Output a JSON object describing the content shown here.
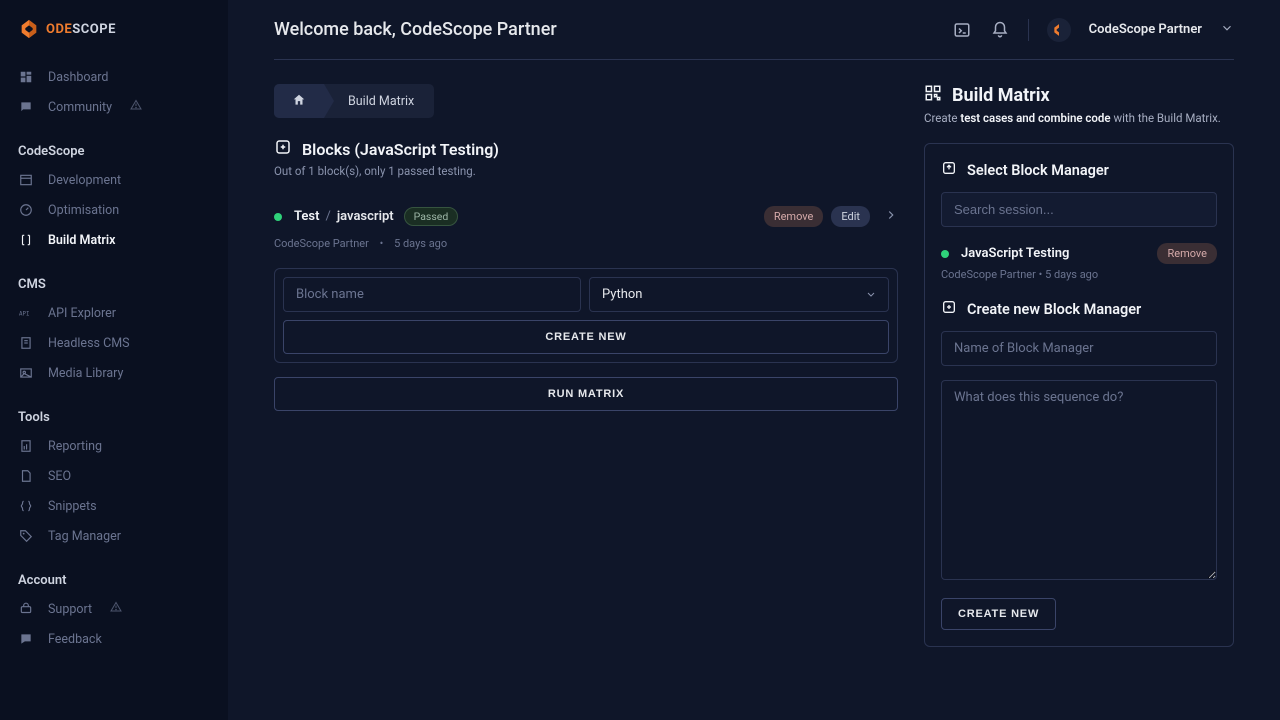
{
  "brand": {
    "code": "ODE",
    "scope": "SCOPE"
  },
  "header": {
    "welcome": "Welcome back, CodeScope Partner",
    "user_name": "CodeScope Partner"
  },
  "sidebar": {
    "top": [
      {
        "label": "Dashboard"
      },
      {
        "label": "Community"
      }
    ],
    "groups": [
      {
        "heading": "CodeScope",
        "items": [
          {
            "label": "Development"
          },
          {
            "label": "Optimisation"
          },
          {
            "label": "Build Matrix",
            "active": true
          }
        ]
      },
      {
        "heading": "CMS",
        "items": [
          {
            "label": "API Explorer"
          },
          {
            "label": "Headless CMS"
          },
          {
            "label": "Media Library"
          }
        ]
      },
      {
        "heading": "Tools",
        "items": [
          {
            "label": "Reporting"
          },
          {
            "label": "SEO"
          },
          {
            "label": "Snippets"
          },
          {
            "label": "Tag Manager"
          }
        ]
      },
      {
        "heading": "Account",
        "items": [
          {
            "label": "Support"
          },
          {
            "label": "Feedback"
          }
        ]
      }
    ]
  },
  "breadcrumb": {
    "current": "Build Matrix"
  },
  "blocks": {
    "title": "Blocks (JavaScript Testing)",
    "subtitle": "Out of 1 block(s), only 1 passed testing.",
    "items": [
      {
        "name": "Test",
        "lang": "javascript",
        "status": "Passed",
        "author": "CodeScope Partner",
        "age": "5 days ago",
        "remove": "Remove",
        "edit": "Edit"
      }
    ],
    "new": {
      "name_placeholder": "Block name",
      "lang_selected": "Python",
      "create": "CREATE NEW"
    },
    "run": "RUN MATRIX"
  },
  "matrix": {
    "title": "Build Matrix",
    "sub_pre": "Create ",
    "sub_bold": "test cases and combine code",
    "sub_post": " with the Build Matrix.",
    "select_heading": "Select Block Manager",
    "search_placeholder": "Search session...",
    "session": {
      "name": "JavaScript Testing",
      "author": "CodeScope Partner",
      "age": "5 days ago",
      "remove": "Remove"
    },
    "create_heading": "Create new Block Manager",
    "name_placeholder": "Name of Block Manager",
    "desc_placeholder": "What does this sequence do?",
    "create_btn": "CREATE NEW"
  }
}
